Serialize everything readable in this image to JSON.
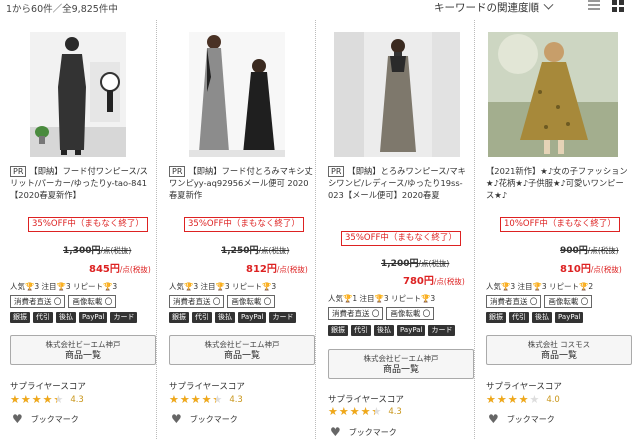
{
  "header": {
    "result_count": "1から60件／全9,825件中",
    "sort_label": "キーワードの関連度順"
  },
  "products": [
    {
      "pr": "PR",
      "title": "【即納】フード付ワンピース/スリット/パーカー/ゆったりy-tao-841【2020春夏新作】",
      "discount": "35%OFF中（まもなく終了）",
      "old_price": "1,300円",
      "old_unit": "/点(税抜)",
      "new_price": "845円",
      "new_unit": "/点(税抜)",
      "stats": "人気🏆3 注目🏆3 リピート🏆3",
      "badges1": [
        "消費者直送 〇",
        "画像転載 〇"
      ],
      "badges2": [
        "銀振",
        "代引",
        "後払",
        "PayPal",
        "カード"
      ],
      "supplier": "株式会社ビーエム神戸",
      "supplier_btn": "商品一覧",
      "score_label": "サプライヤースコア",
      "score": "4.3",
      "score_num": 4.3,
      "bookmark": "ブックマーク"
    },
    {
      "pr": "PR",
      "title": "【即納】フード付とろみマキシ丈ワンピyy-aq92956メール便可 2020春夏新作",
      "discount": "35%OFF中（まもなく終了）",
      "old_price": "1,250円",
      "old_unit": "/点(税抜)",
      "new_price": "812円",
      "new_unit": "/点(税抜)",
      "stats": "人気🏆3 注目🏆3 リピート🏆3",
      "badges1": [
        "消費者直送 〇",
        "画像転載 〇"
      ],
      "badges2": [
        "銀振",
        "代引",
        "後払",
        "PayPal",
        "カード"
      ],
      "supplier": "株式会社ビーエム神戸",
      "supplier_btn": "商品一覧",
      "score_label": "サプライヤースコア",
      "score": "4.3",
      "score_num": 4.3,
      "bookmark": "ブックマーク"
    },
    {
      "pr": "PR",
      "title": "【即納】とろみワンピース/マキシワンピ/レディース/ゆったり19ss-023【メール便可】2020春夏",
      "discount": "35%OFF中（まもなく終了）",
      "old_price": "1,200円",
      "old_unit": "/点(税抜)",
      "new_price": "780円",
      "new_unit": "/点(税抜)",
      "stats": "人気🏆1 注目🏆3 リピート🏆3",
      "badges1": [
        "消費者直送 〇",
        "画像転載 〇"
      ],
      "badges2": [
        "銀振",
        "代引",
        "後払",
        "PayPal",
        "カード"
      ],
      "supplier": "株式会社ビーエム神戸",
      "supplier_btn": "商品一覧",
      "score_label": "サプライヤースコア",
      "score": "4.3",
      "score_num": 4.3,
      "bookmark": "ブックマーク"
    },
    {
      "pr": "",
      "title": "【2021新作】★♪女の子ファッション★♪花柄★♪子供服★♪可愛いワンピース★♪",
      "discount": "10%OFF中（まもなく終了）",
      "old_price": "900円",
      "old_unit": "/点(税抜)",
      "new_price": "810円",
      "new_unit": "/点(税抜)",
      "stats": "人気🏆3 注目🏆3 リピート🏆2",
      "badges1": [
        "消費者直送 〇",
        "画像転載 〇"
      ],
      "badges2": [
        "銀振",
        "代引",
        "後払",
        "PayPal"
      ],
      "supplier": "株式会社 コスモス",
      "supplier_btn": "商品一覧",
      "score_label": "サプライヤースコア",
      "score": "4.0",
      "score_num": 4.0,
      "bookmark": "ブックマーク"
    }
  ],
  "colors": {
    "discount_red": "#d22222",
    "star_gold": "#f0a818"
  }
}
